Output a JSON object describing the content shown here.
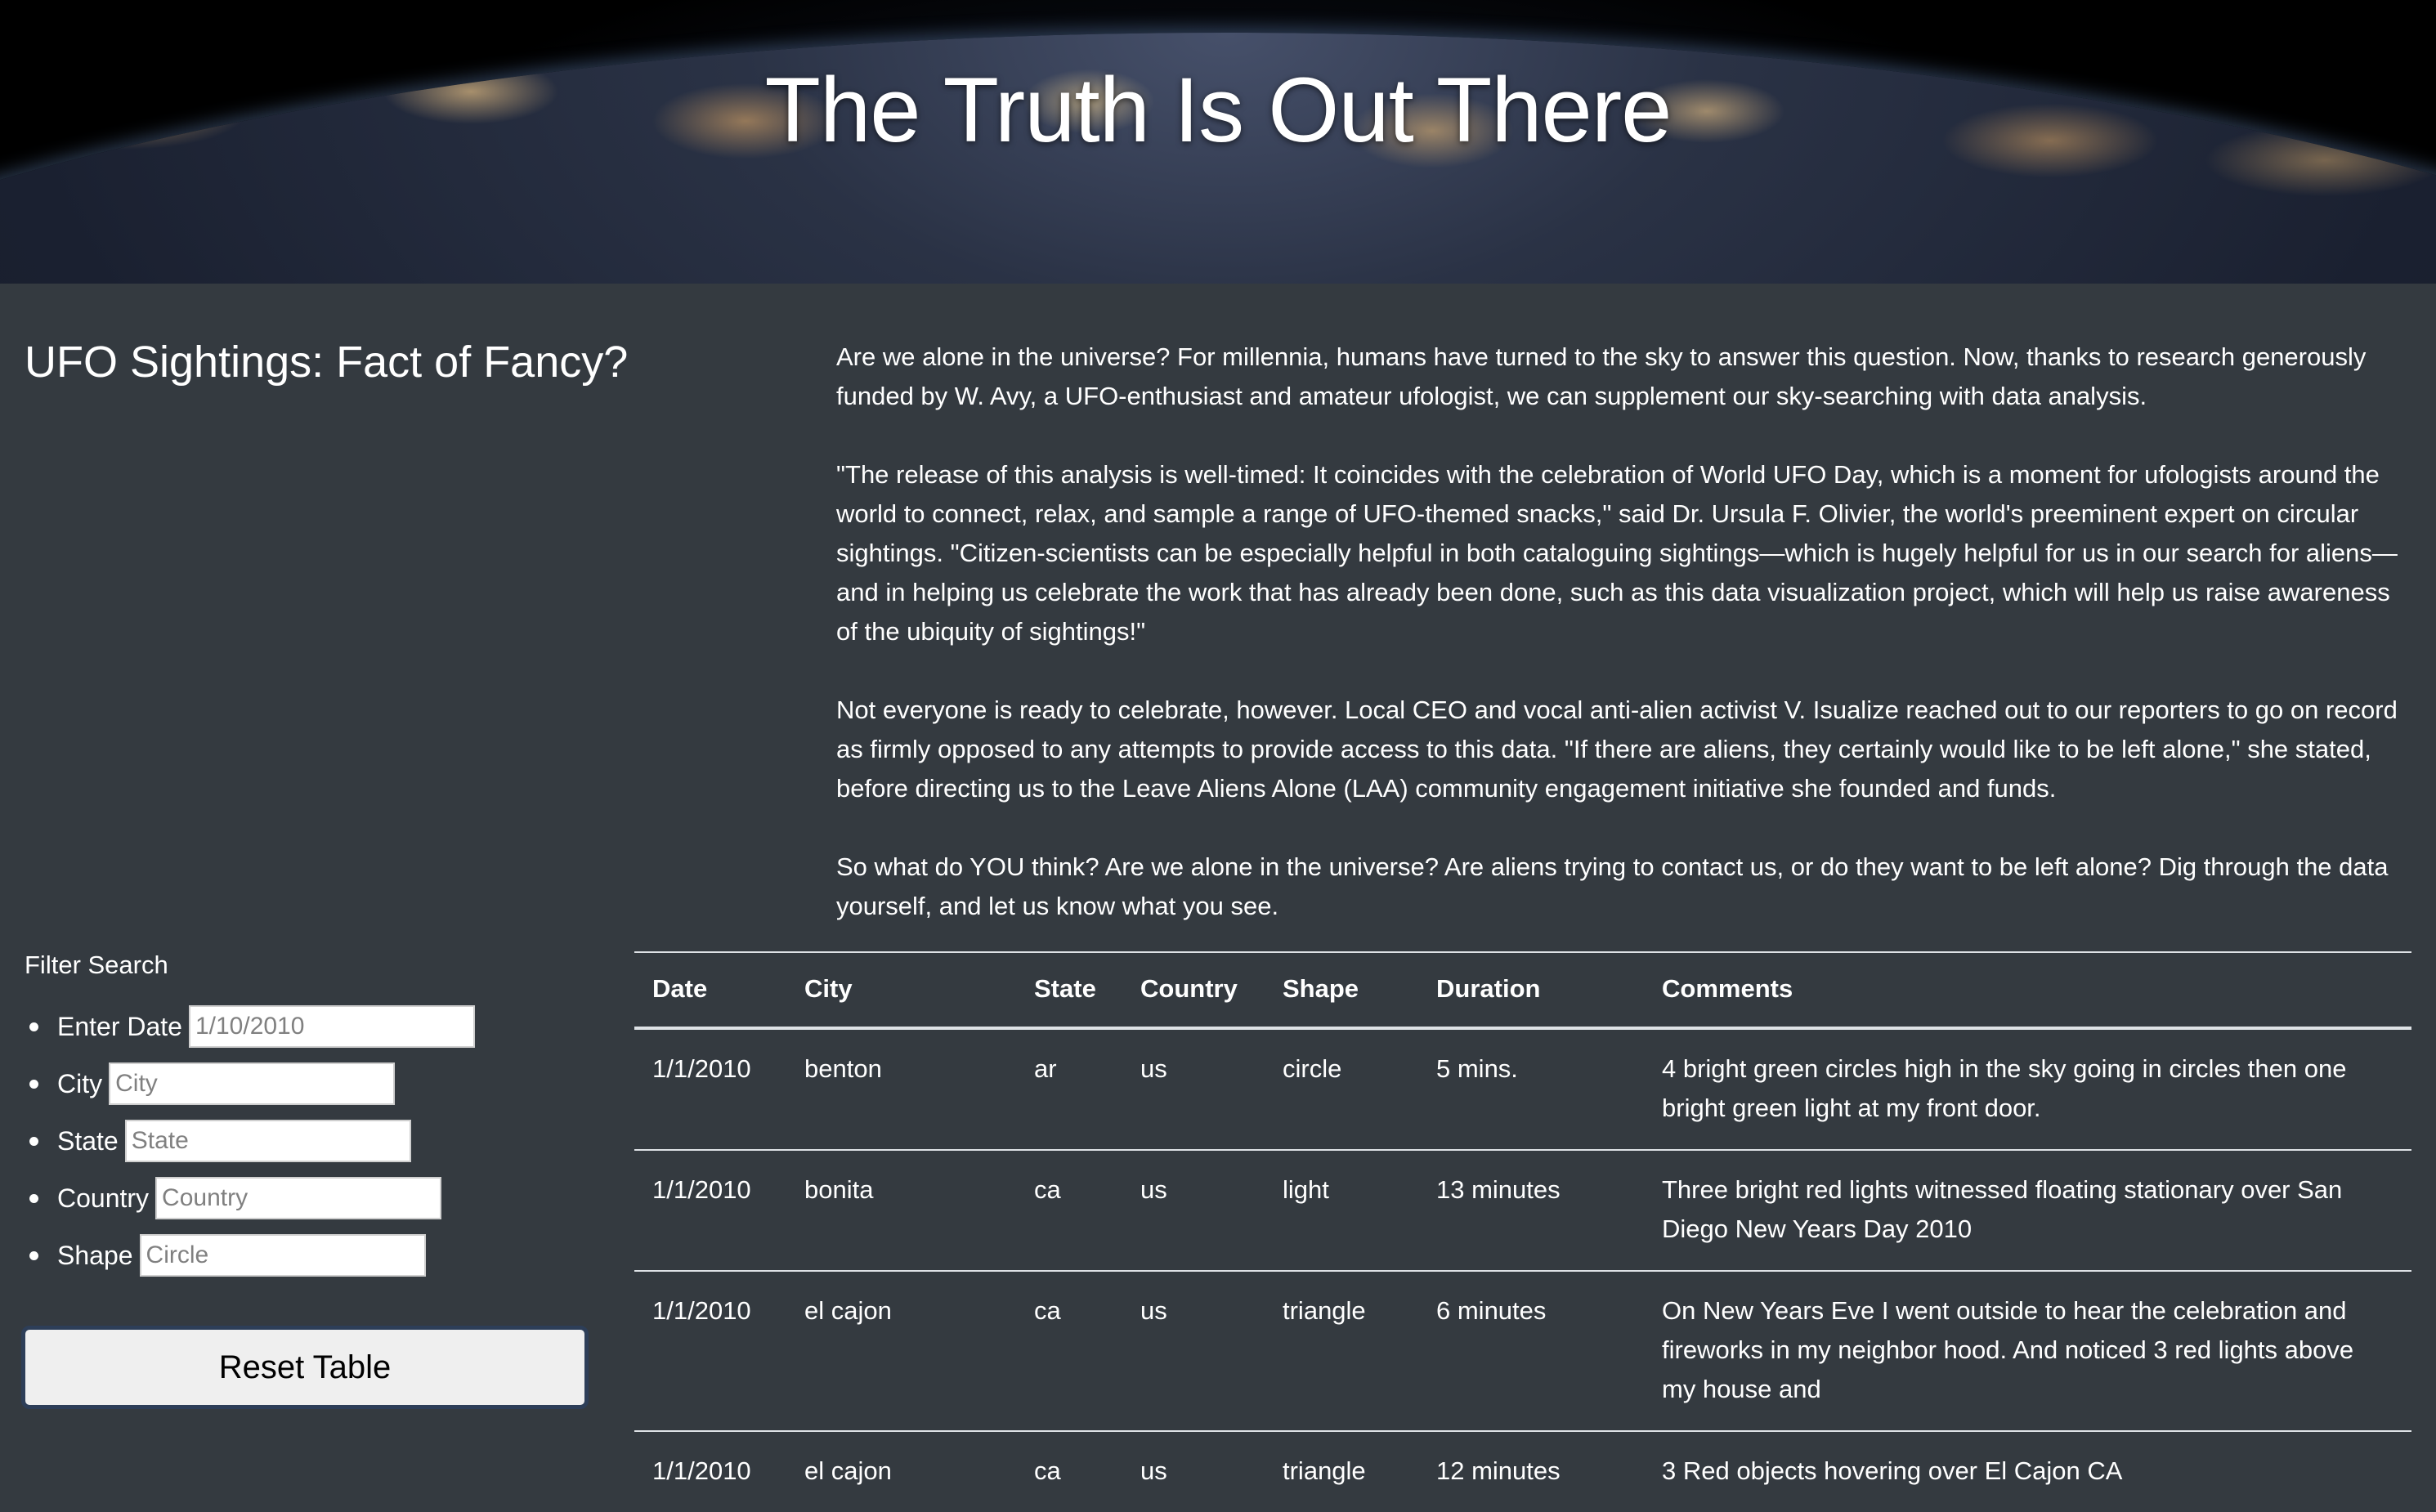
{
  "header": {
    "title": "The Truth Is Out There"
  },
  "page": {
    "heading": "UFO Sightings: Fact of Fancy?",
    "paragraphs": [
      "Are we alone in the universe? For millennia, humans have turned to the sky to answer this question. Now, thanks to research generously funded by W. Avy, a UFO-enthusiast and amateur ufologist, we can supplement our sky-searching with data analysis.",
      "\"The release of this analysis is well-timed: It coincides with the celebration of World UFO Day, which is a moment for ufologists around the world to connect, relax, and sample a range of UFO-themed snacks,\" said Dr. Ursula F. Olivier, the world's preeminent expert on circular sightings. \"Citizen-scientists can be especially helpful in both cataloguing sightings—which is hugely helpful for us in our search for aliens—and in helping us celebrate the work that has already been done, such as this data visualization project, which will help us raise awareness of the ubiquity of sightings!\"",
      "Not everyone is ready to celebrate, however. Local CEO and vocal anti-alien activist V. Isualize reached out to our reporters to go on record as firmly opposed to any attempts to provide access to this data. \"If there are aliens, they certainly would like to be left alone,\" she stated, before directing us to the Leave Aliens Alone (LAA) community engagement initiative she founded and funds.",
      "So what do YOU think? Are we alone in the universe? Are aliens trying to contact us, or do they want to be left alone? Dig through the data yourself, and let us know what you see."
    ]
  },
  "filters": {
    "title": "Filter Search",
    "items": [
      {
        "label": "Enter Date",
        "placeholder": "1/10/2010",
        "value": ""
      },
      {
        "label": "City",
        "placeholder": "City",
        "value": ""
      },
      {
        "label": "State",
        "placeholder": "State",
        "value": ""
      },
      {
        "label": "Country",
        "placeholder": "Country",
        "value": ""
      },
      {
        "label": "Shape",
        "placeholder": "Circle",
        "value": ""
      }
    ],
    "reset_label": "Reset Table"
  },
  "table": {
    "columns": [
      "Date",
      "City",
      "State",
      "Country",
      "Shape",
      "Duration",
      "Comments"
    ],
    "rows": [
      [
        "1/1/2010",
        "benton",
        "ar",
        "us",
        "circle",
        "5 mins.",
        "4 bright green circles high in the sky going in circles then one bright green light at my front door."
      ],
      [
        "1/1/2010",
        "bonita",
        "ca",
        "us",
        "light",
        "13 minutes",
        "Three bright red lights witnessed floating stationary over San Diego New Years Day 2010"
      ],
      [
        "1/1/2010",
        "el cajon",
        "ca",
        "us",
        "triangle",
        "6 minutes",
        "On New Years Eve I went outside to hear the celebration and fireworks in my neighbor hood. And noticed 3 red lights above my house and"
      ],
      [
        "1/1/2010",
        "el cajon",
        "ca",
        "us",
        "triangle",
        "12 minutes",
        "3 Red objects hovering over El Cajon CA"
      ]
    ]
  }
}
